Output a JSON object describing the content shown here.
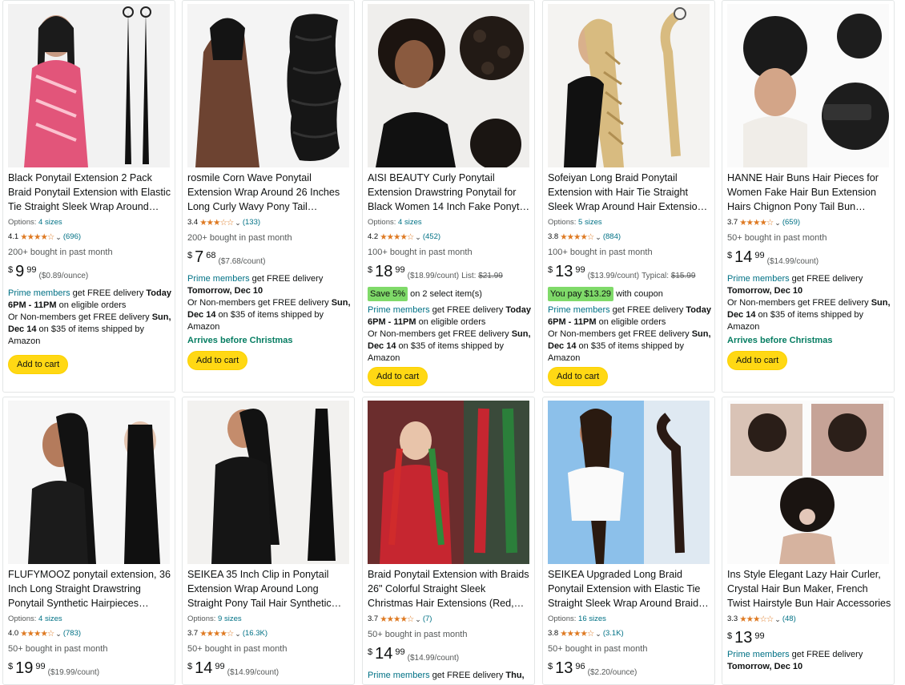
{
  "products": [
    {
      "title": "Black Ponytail Extension 2 Pack Braid Ponytail Extension with Elastic Tie Straight Sleek Wrap Around Braid…",
      "options_label": "Options:",
      "options_value": "4 sizes",
      "rating_value": "4.1",
      "stars": "★★★★☆",
      "review_count": "(696)",
      "bought": "200+ bought in past month",
      "price_symbol": "$",
      "price_whole": "9",
      "price_fraction": "99",
      "unit_price": "($0.89/ounce)",
      "prime_label": "Prime members",
      "delivery1": " get FREE delivery ",
      "delivery1_bold": "Today 6PM - 11PM",
      "delivery1_tail": " on eligible orders",
      "delivery2": "Or Non-members get FREE delivery ",
      "delivery2_bold": "Sun, Dec 14",
      "delivery2_tail": " on $35 of items shipped by Amazon",
      "cart_label": "Add to cart",
      "image_icon": "braided-ponytail-photo"
    },
    {
      "title": "rosmile Corn Wave Ponytail Extension Wrap Around 26 Inches Long Curly Wavy Pony Tail Extensi…",
      "rating_value": "3.4",
      "stars": "★★★☆☆",
      "review_count": "(133)",
      "bought": "200+ bought in past month",
      "price_symbol": "$",
      "price_whole": "7",
      "price_fraction": "68",
      "unit_price": "($7.68/count)",
      "prime_label": "Prime members",
      "delivery1": " get FREE delivery ",
      "delivery1_bold": "Tomorrow, Dec 10",
      "delivery1_tail": "",
      "delivery2": "Or Non-members get FREE delivery ",
      "delivery2_bold": "Sun, Dec 14",
      "delivery2_tail": " on $35 of items shipped by Amazon",
      "green_note": "Arrives before Christmas",
      "cart_label": "Add to cart",
      "image_icon": "wavy-ponytail-photo"
    },
    {
      "title": "AISI BEAUTY Curly Ponytail Extension Drawstring Ponytail for Black Women 14 Inch Fake Ponytail Curly Synthe…",
      "options_label": "Options:",
      "options_value": "4 sizes",
      "rating_value": "4.2",
      "stars": "★★★★☆",
      "review_count": "(452)",
      "bought": "100+ bought in past month",
      "price_symbol": "$",
      "price_whole": "18",
      "price_fraction": "99",
      "unit_price": "($18.99/count)",
      "list_label": "List:",
      "list_price": "$21.99",
      "badge": "Save 5%",
      "badge_tail": " on 2 select item(s)",
      "prime_label": "Prime members",
      "delivery1": " get FREE delivery ",
      "delivery1_bold": "Today 6PM - 11PM",
      "delivery1_tail": " on eligible orders",
      "delivery2": "Or Non-members get FREE delivery ",
      "delivery2_bold": "Sun, Dec 14",
      "delivery2_tail": " on $35 of items shipped by Amazon",
      "cart_label": "Add to cart",
      "image_icon": "curly-ponytail-photo"
    },
    {
      "title": "Sofeiyan Long Braid Ponytail Extension with Hair Tie Straight Sleek Wrap Around Hair Extensions Braid…",
      "options_label": "Options:",
      "options_value": "5 sizes",
      "rating_value": "3.8",
      "stars": "★★★★☆",
      "review_count": "(884)",
      "bought": "100+ bought in past month",
      "price_symbol": "$",
      "price_whole": "13",
      "price_fraction": "99",
      "unit_price": "($13.99/count)",
      "list_label": "Typical:",
      "list_price": "$15.99",
      "badge": "You pay $13.29",
      "badge_tail": " with coupon",
      "prime_label": "Prime members",
      "delivery1": " get FREE delivery ",
      "delivery1_bold": "Today 6PM - 11PM",
      "delivery1_tail": " on eligible orders",
      "delivery2": "Or Non-members get FREE delivery ",
      "delivery2_bold": "Sun, Dec 14",
      "delivery2_tail": " on $35 of items shipped by Amazon",
      "cart_label": "Add to cart",
      "image_icon": "blonde-braid-photo"
    },
    {
      "title": "HANNE Hair Buns Hair Pieces for Women Fake Hair Bun Extension Hairs Chignon Pony Tail Bun Artifici…",
      "rating_value": "3.7",
      "stars": "★★★★☆",
      "review_count": "(659)",
      "bought": "50+ bought in past month",
      "price_symbol": "$",
      "price_whole": "14",
      "price_fraction": "99",
      "unit_price": "($14.99/count)",
      "prime_label": "Prime members",
      "delivery1": " get FREE delivery ",
      "delivery1_bold": "Tomorrow, Dec 10",
      "delivery1_tail": "",
      "delivery2": "Or Non-members get FREE delivery ",
      "delivery2_bold": "Sun, Dec 14",
      "delivery2_tail": " on $35 of items shipped by Amazon",
      "green_note": "Arrives before Christmas",
      "cart_label": "Add to cart",
      "image_icon": "hair-bun-photo"
    },
    {
      "title": "FLUFYMOOZ ponytail extension, 36 Inch Long Straight Drawstring Ponytail Synthetic Hairpieces Fake…",
      "options_label": "Options:",
      "options_value": "4 sizes",
      "rating_value": "4.0",
      "stars": "★★★★☆",
      "review_count": "(783)",
      "bought": "50+ bought in past month",
      "price_symbol": "$",
      "price_whole": "19",
      "price_fraction": "99",
      "unit_price": "($19.99/count)",
      "image_icon": "long-straight-ponytail-photo"
    },
    {
      "title": "SEIKEA 35 Inch Clip in Ponytail Extension Wrap Around Long Straight Pony Tail Hair Synthetic…",
      "options_label": "Options:",
      "options_value": "9 sizes",
      "rating_value": "3.7",
      "stars": "★★★★☆",
      "review_count": "(16.3K)",
      "bought": "50+ bought in past month",
      "price_symbol": "$",
      "price_whole": "14",
      "price_fraction": "99",
      "unit_price": "($14.99/count)",
      "image_icon": "clip-ponytail-photo"
    },
    {
      "title": "Braid Ponytail Extension with Braids 26\" Colorful Straight Sleek Christmas Hair Extensions (Red, White, Green)",
      "rating_value": "3.7",
      "stars": "★★★★☆",
      "review_count": "(7)",
      "bought": "50+ bought in past month",
      "price_symbol": "$",
      "price_whole": "14",
      "price_fraction": "99",
      "unit_price": "($14.99/count)",
      "prime_label": "Prime members",
      "delivery1": " get FREE delivery ",
      "delivery1_bold": "Thu,",
      "image_icon": "christmas-braid-photo"
    },
    {
      "title": "SEIKEA Upgraded Long Braid Ponytail Extension with Elastic Tie Straight Sleek Wrap Around Braid…",
      "options_label": "Options:",
      "options_value": "16 sizes",
      "rating_value": "3.8",
      "stars": "★★★★☆",
      "review_count": "(3.1K)",
      "bought": "50+ bought in past month",
      "price_symbol": "$",
      "price_whole": "13",
      "price_fraction": "96",
      "unit_price": "($2.20/ounce)",
      "image_icon": "brown-braid-photo"
    },
    {
      "title": "Ins Style Elegant Lazy Hair Curler, Crystal Hair Bun Maker, French Twist Hairstyle Bun Hair Accessories",
      "rating_value": "3.3",
      "stars": "★★★☆☆",
      "review_count": "(48)",
      "price_symbol": "$",
      "price_whole": "13",
      "price_fraction": "99",
      "prime_label": "Prime members",
      "delivery1": " get FREE delivery",
      "delivery1_bold": "",
      "delivery_line2_bold": "Tomorrow, Dec 10",
      "image_icon": "bun-maker-photo"
    }
  ]
}
